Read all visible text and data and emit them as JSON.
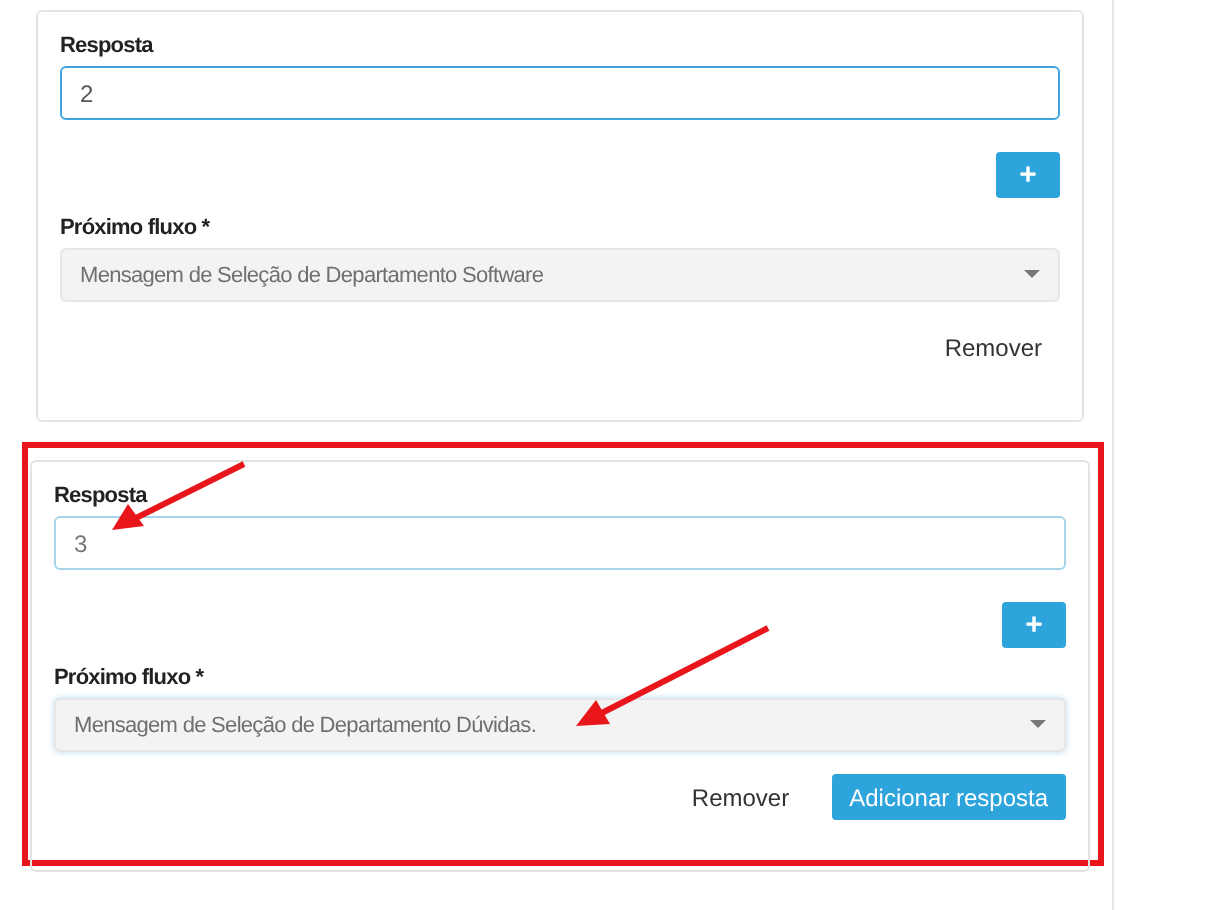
{
  "cards": [
    {
      "highlighted": false,
      "answer": {
        "label": "Resposta",
        "value": "2",
        "focused": true
      },
      "add_button": "+",
      "flow": {
        "label": "Próximo fluxo *",
        "value": "Mensagem de Seleção de Departamento Software"
      },
      "buttons": [
        {
          "label": "Remover",
          "kind": "link"
        }
      ]
    },
    {
      "highlighted": true,
      "answer": {
        "label": "Resposta",
        "value": "3",
        "focused": false
      },
      "add_button": "+",
      "flow": {
        "label": "Próximo fluxo *",
        "value": "Mensagem de Seleção de Departamento Dúvidas."
      },
      "buttons": [
        {
          "label": "Remover",
          "kind": "link"
        },
        {
          "label": "Adicionar resposta",
          "kind": "primary"
        }
      ]
    }
  ]
}
